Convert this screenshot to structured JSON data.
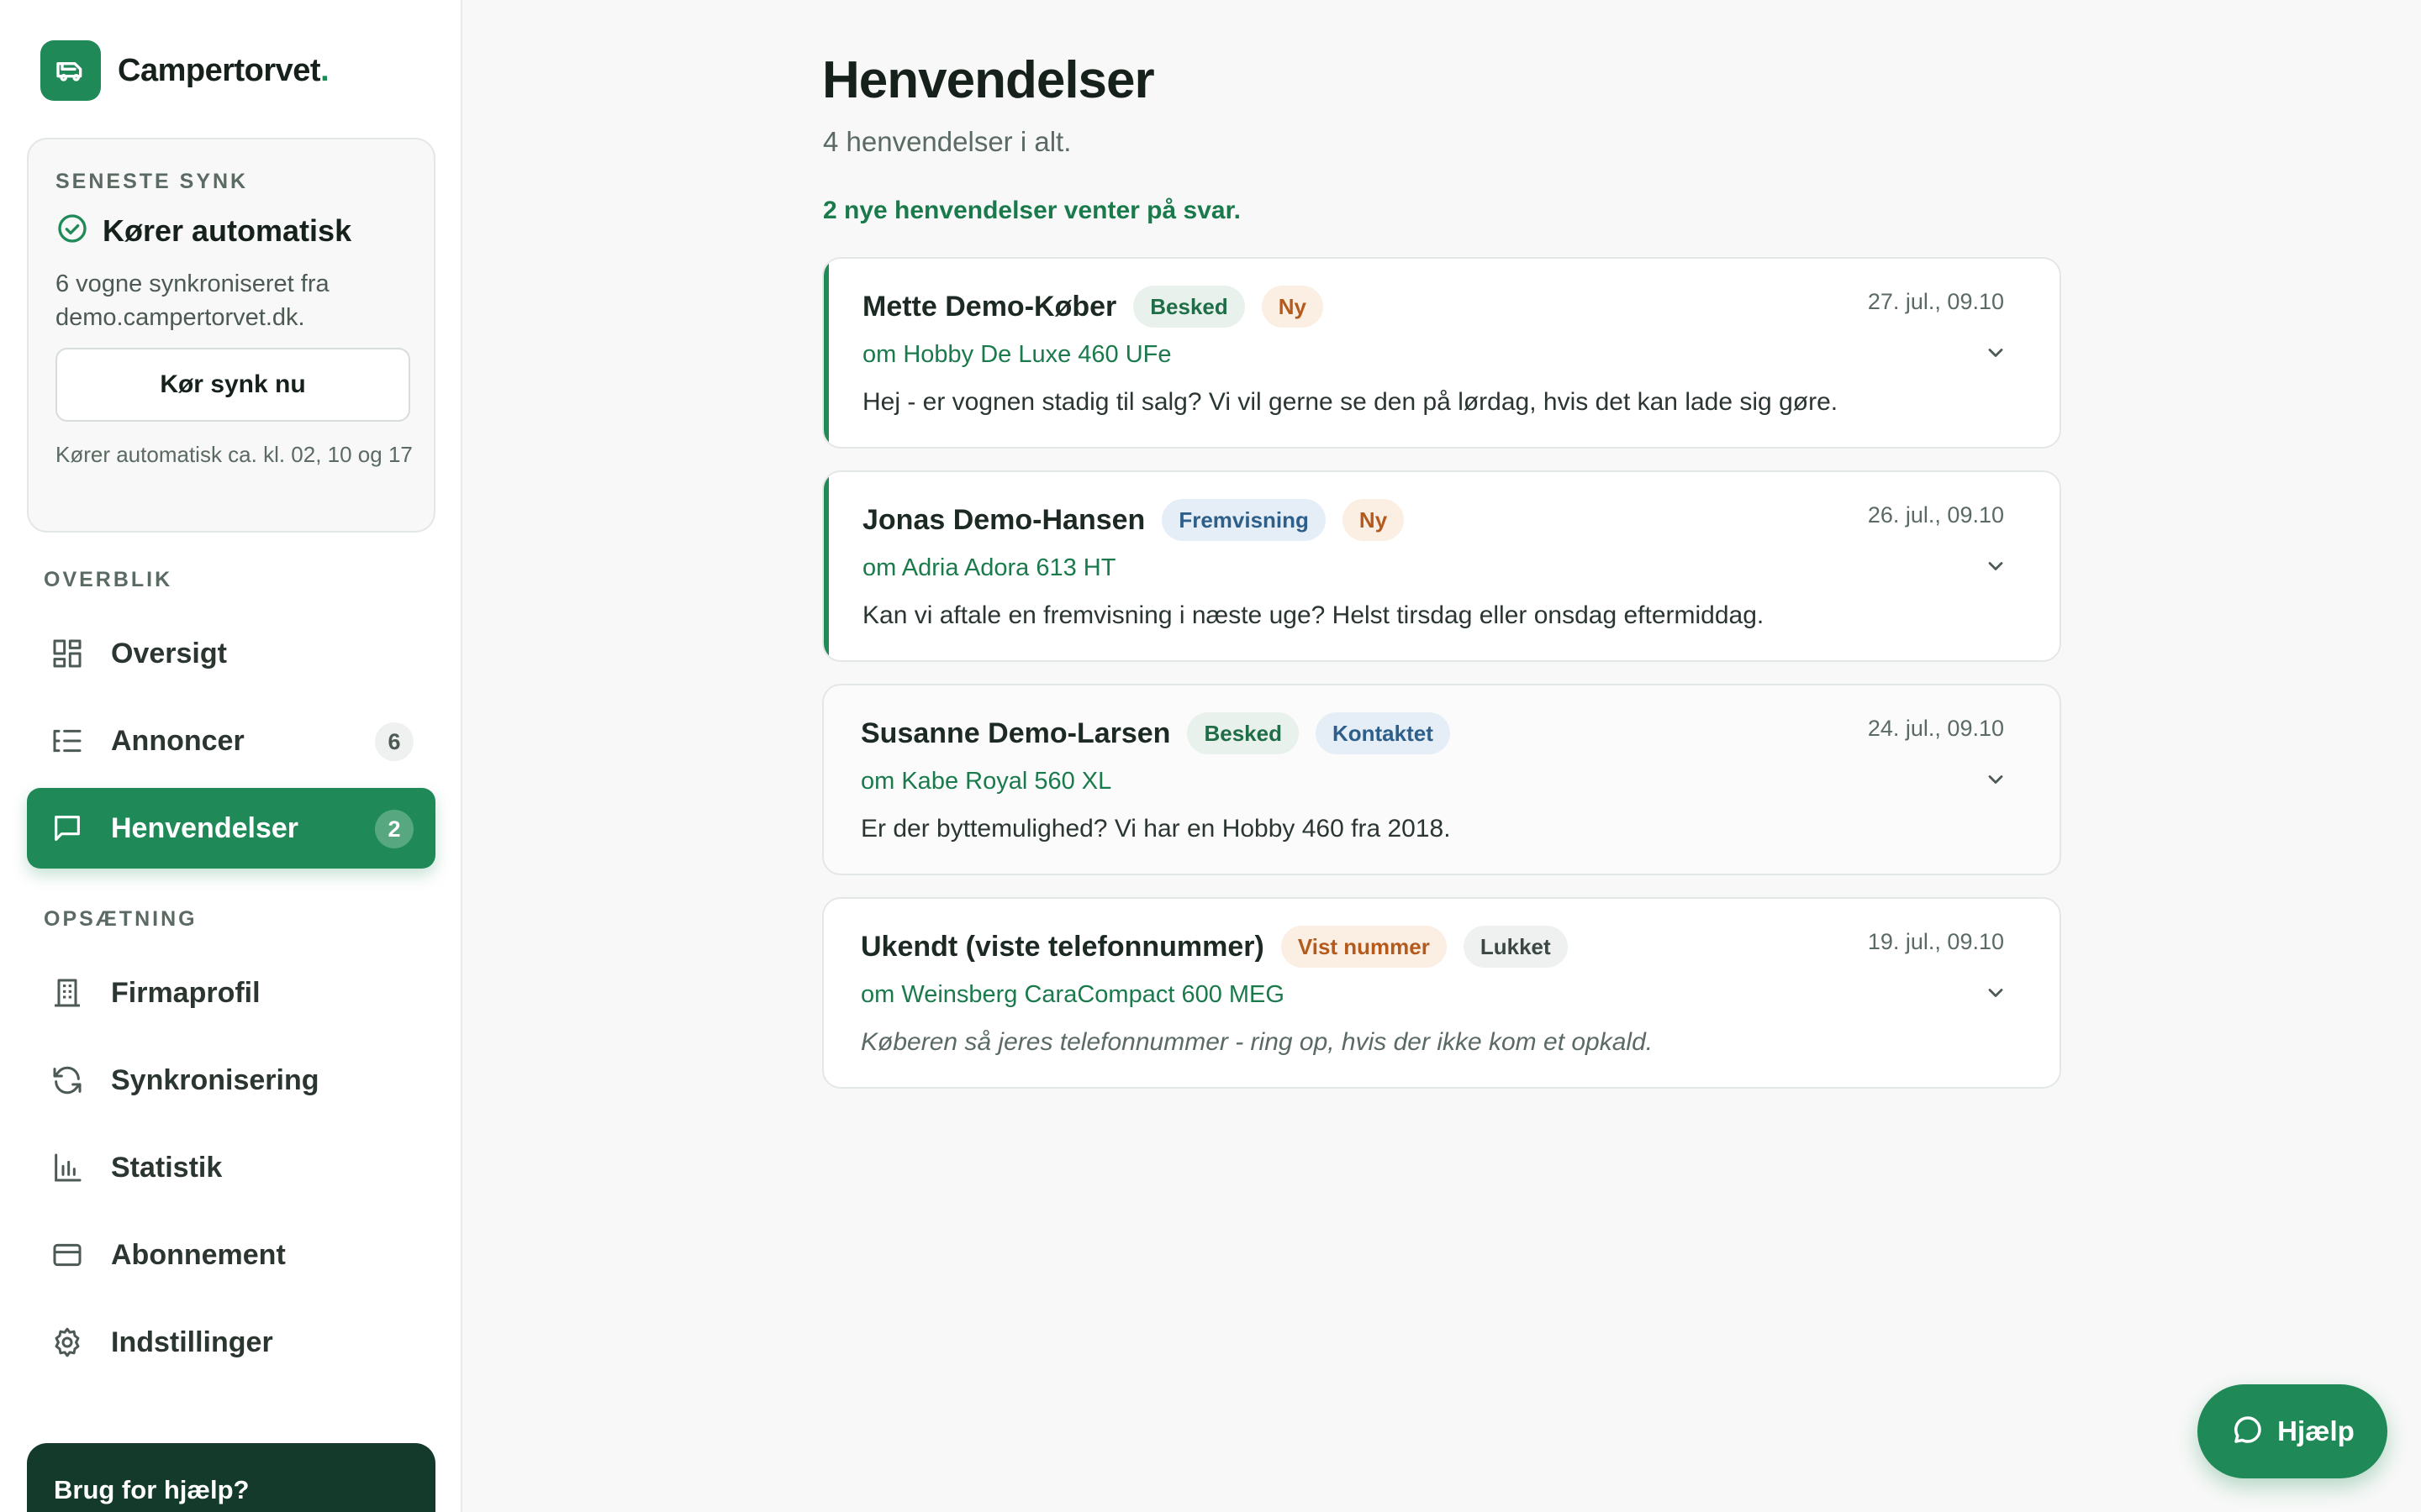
{
  "brand": {
    "name": "Campertorvet",
    "dot": ".",
    "icon": "camper-icon",
    "color": "#1f8a57"
  },
  "sync": {
    "eyebrow": "SENESTE SYNK",
    "status": "Kører automatisk",
    "description": "6 vogne synkroniseret fra demo.campertorvet.dk.",
    "button_label": "Kør synk nu",
    "note": "Kører automatisk ca. kl. 02, 10 og 17"
  },
  "nav": {
    "section_overview": "OVERBLIK",
    "section_setup": "OPSÆTNING",
    "items": [
      {
        "label": "Oversigt",
        "icon": "dashboard-icon"
      },
      {
        "label": "Annoncer",
        "icon": "list-icon",
        "badge": "6"
      },
      {
        "label": "Henvendelser",
        "icon": "message-icon",
        "badge": "2",
        "active": true
      },
      {
        "label": "Firmaprofil",
        "icon": "building-icon"
      },
      {
        "label": "Synkronisering",
        "icon": "sync-icon"
      },
      {
        "label": "Statistik",
        "icon": "bar-chart-icon"
      },
      {
        "label": "Abonnement",
        "icon": "credit-card-icon"
      },
      {
        "label": "Indstillinger",
        "icon": "gear-icon"
      }
    ]
  },
  "help_card": {
    "title": "Brug for hjælp?"
  },
  "page": {
    "title": "Henvendelser",
    "subtitle": "4 henvendelser i alt.",
    "notice": "2 nye henvendelser venter på svar."
  },
  "inquiries": [
    {
      "name": "Mette Demo-Køber",
      "tags": [
        {
          "label": "Besked",
          "tone": "green"
        },
        {
          "label": "Ny",
          "tone": "orange"
        }
      ],
      "vehicle": "om Hobby De Luxe 460 UFe",
      "message": "Hej - er vognen stadig til salg? Vi vil gerne se den på lørdag, hvis det kan lade sig gøre.",
      "date": "27. jul., 09.10",
      "is_new": true
    },
    {
      "name": "Jonas Demo-Hansen",
      "tags": [
        {
          "label": "Fremvisning",
          "tone": "blue"
        },
        {
          "label": "Ny",
          "tone": "orange"
        }
      ],
      "vehicle": "om Adria Adora 613 HT",
      "message": "Kan vi aftale en fremvisning i næste uge? Helst tirsdag eller onsdag eftermiddag.",
      "date": "26. jul., 09.10",
      "is_new": true
    },
    {
      "name": "Susanne Demo-Larsen",
      "tags": [
        {
          "label": "Besked",
          "tone": "green"
        },
        {
          "label": "Kontaktet",
          "tone": "blue"
        }
      ],
      "vehicle": "om Kabe Royal 560 XL",
      "message": "Er der byttemulighed? Vi har en Hobby 460 fra 2018.",
      "date": "24. jul., 09.10",
      "is_new": false
    },
    {
      "name": "Ukendt (viste telefonnummer)",
      "tags": [
        {
          "label": "Vist nummer",
          "tone": "orange"
        },
        {
          "label": "Lukket",
          "tone": "gray"
        }
      ],
      "vehicle": "om Weinsberg CaraCompact 600 MEG",
      "message": "Køberen så jeres telefonnummer - ring op, hvis der ikke kom et opkald.",
      "date": "19. jul., 09.10",
      "is_new": false,
      "italic": true
    }
  ],
  "help_fab": {
    "label": "Hjælp",
    "icon": "chat-bubble-icon"
  }
}
